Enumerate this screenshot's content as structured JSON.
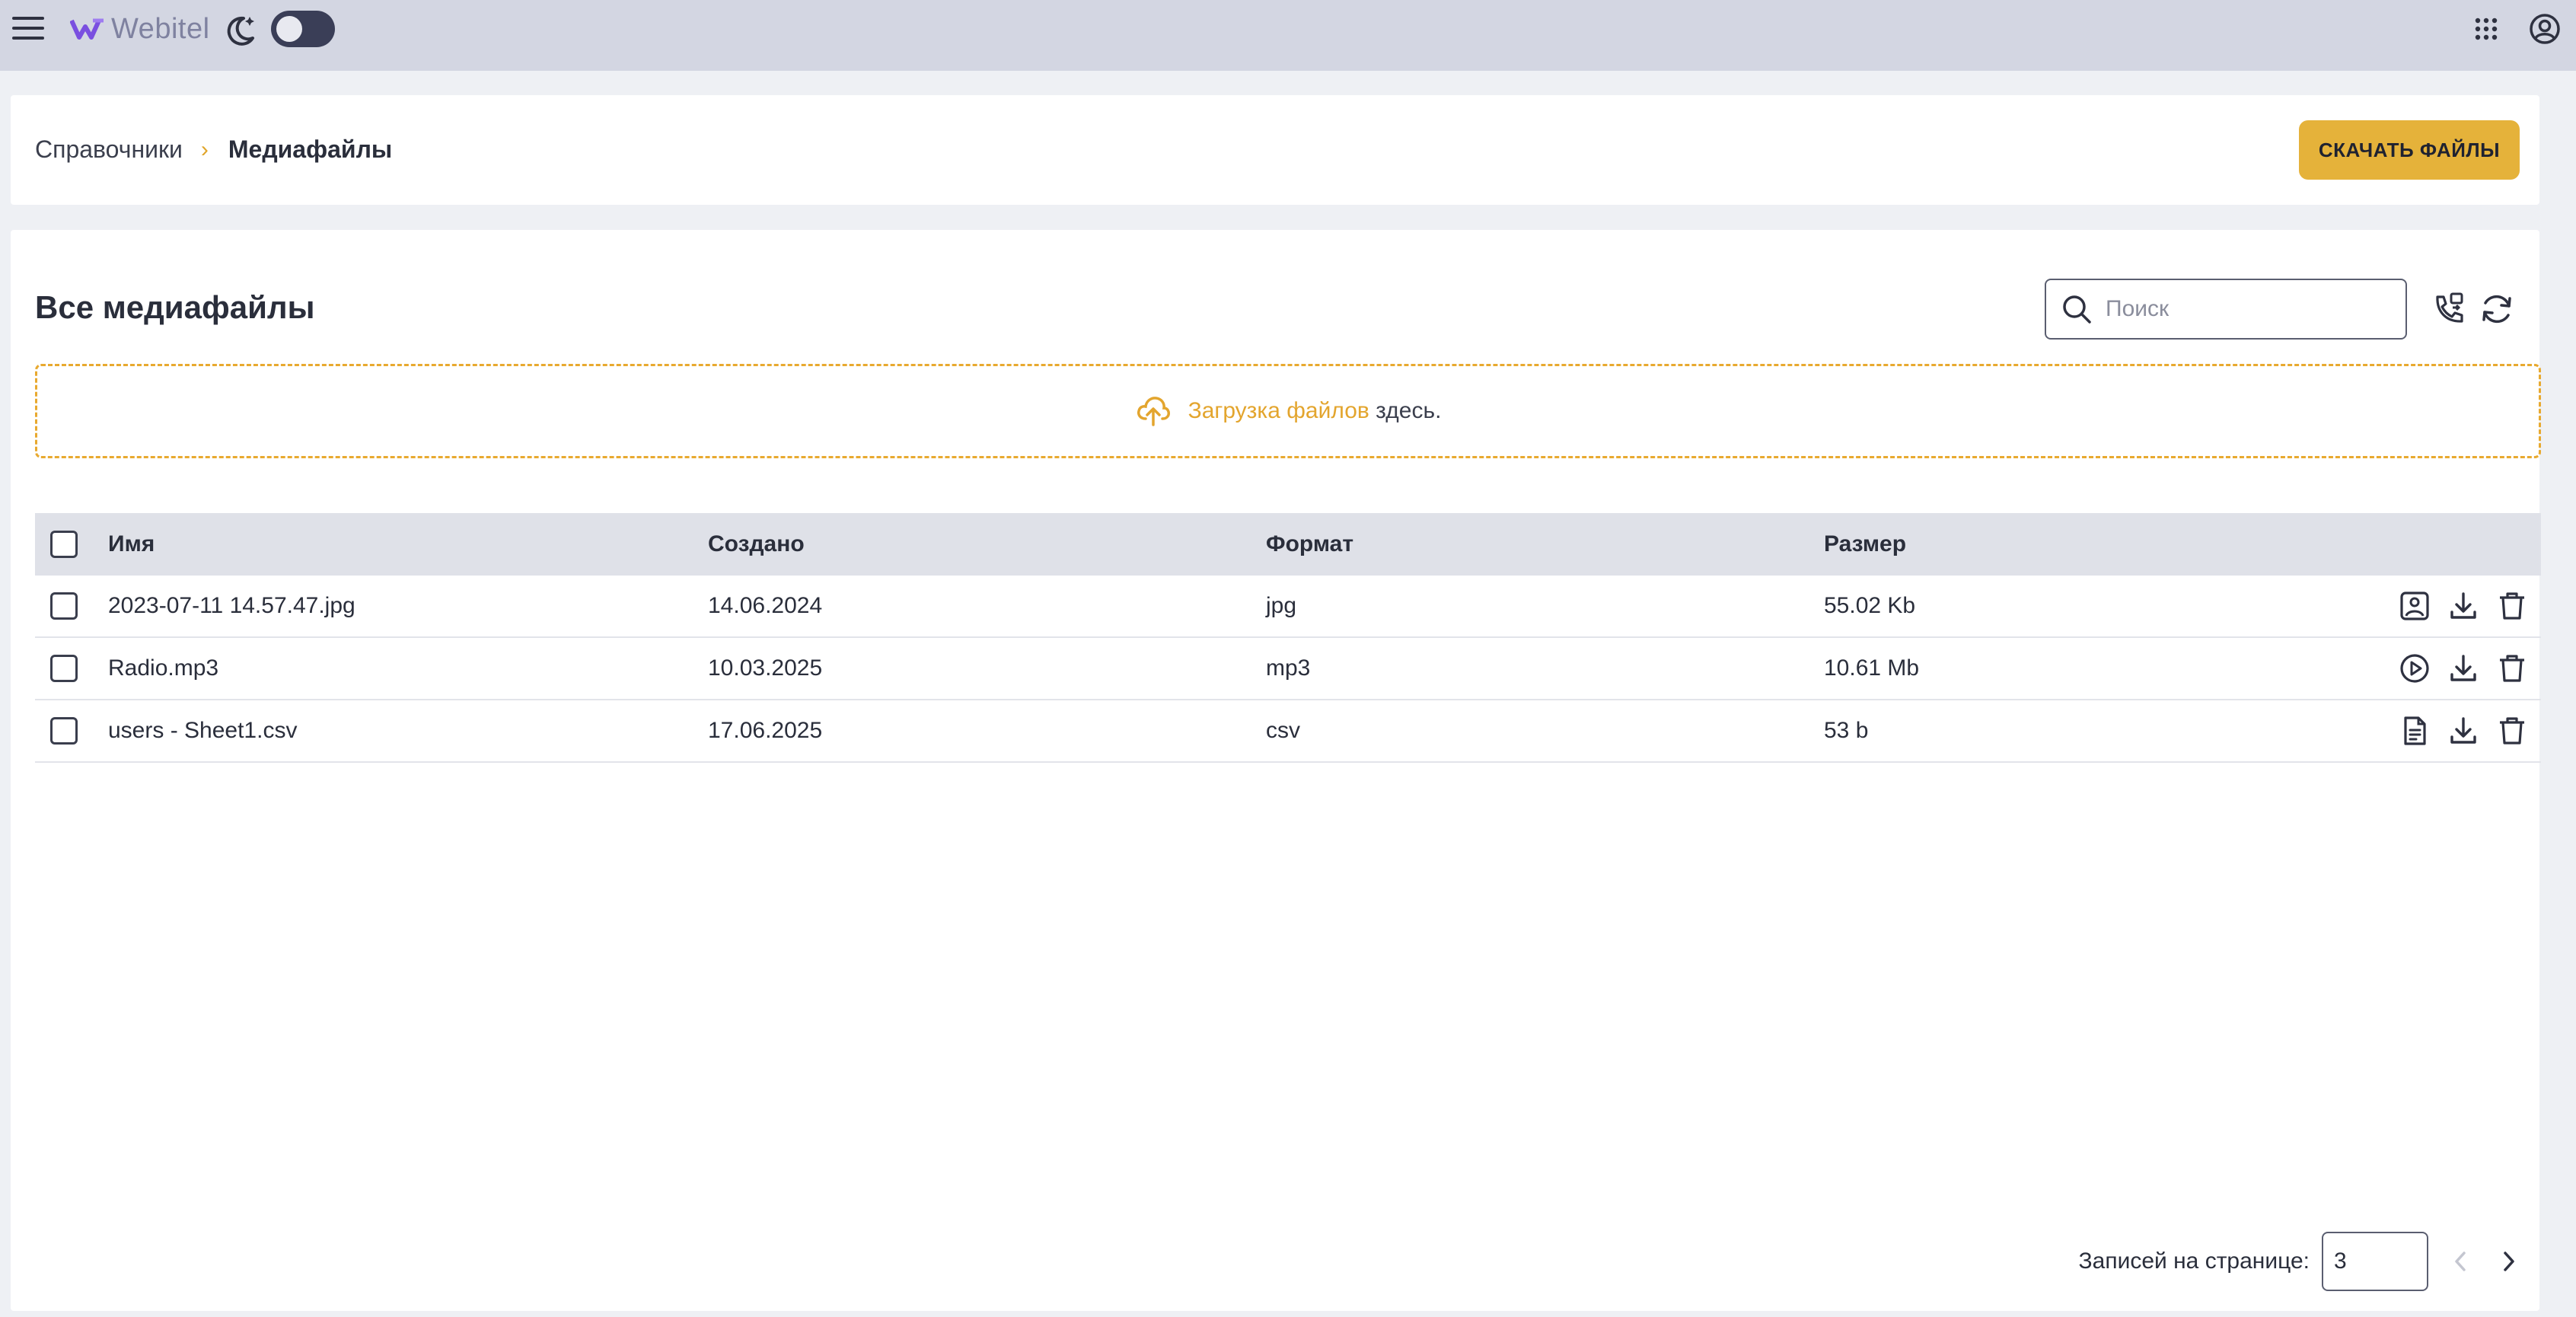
{
  "app": {
    "logo_text": "Webitel"
  },
  "header": {
    "breadcrumb": {
      "parent": "Справочники",
      "separator": "›",
      "current": "Медиафайлы"
    },
    "download_button": "СКАЧАТЬ ФАЙЛЫ"
  },
  "main": {
    "title": "Все медиафайлы",
    "search": {
      "placeholder": "Поиск",
      "value": ""
    },
    "dropzone": {
      "link_text": "Загрузка файлов",
      "rest_text": "здесь."
    },
    "table": {
      "columns": [
        "Имя",
        "Создано",
        "Формат",
        "Размер"
      ],
      "rows": [
        {
          "name": "2023-07-11 14.57.47.jpg",
          "created": "14.06.2024",
          "format": "jpg",
          "size": "55.02 Kb",
          "preview_icon": "image-icon"
        },
        {
          "name": "Radio.mp3",
          "created": "10.03.2025",
          "format": "mp3",
          "size": "10.61 Mb",
          "preview_icon": "play-icon"
        },
        {
          "name": "users - Sheet1.csv",
          "created": "17.06.2025",
          "format": "csv",
          "size": "53 b",
          "preview_icon": "document-icon"
        }
      ]
    },
    "pagination": {
      "label": "Записей на странице:",
      "per_page": "3"
    }
  },
  "colors": {
    "accent": "#e5b23a",
    "topbar": "#d3d6e2",
    "table_header": "#dfe1e8",
    "text": "#2a2e3b"
  }
}
